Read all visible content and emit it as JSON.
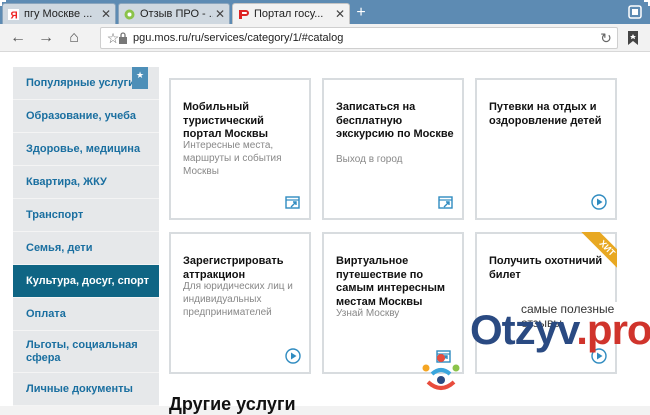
{
  "browser": {
    "tabs": [
      {
        "label": "пгу Москве ..."
      },
      {
        "label": "Отзыв ПРО - ..."
      },
      {
        "label": "Портал госу..."
      }
    ],
    "new_tab": "+",
    "address": "pgu.mos.ru/ru/services/category/1/#catalog"
  },
  "sidebar": {
    "items": [
      {
        "label": "Популярные услуги"
      },
      {
        "label": "Образование, учеба"
      },
      {
        "label": "Здоровье, медицина"
      },
      {
        "label": "Квартира, ЖКУ"
      },
      {
        "label": "Транспорт"
      },
      {
        "label": "Семья, дети"
      },
      {
        "label": "Культура, досуг, спорт"
      },
      {
        "label": "Оплата"
      },
      {
        "label": "Льготы, социальная сфера"
      },
      {
        "label": "Личные документы"
      }
    ],
    "badge": "★"
  },
  "cards": [
    {
      "title": "Мобильный туристический портал Москвы",
      "sub": "Интересные места, маршруты и события Москвы"
    },
    {
      "title": "Записаться на бесплатную экскурсию по Москве",
      "sub": "Выход в город"
    },
    {
      "title": "Путевки на отдых и оздоровление детей",
      "sub": ""
    },
    {
      "title": "Зарегистрировать аттракцион",
      "sub": "Для юридических лиц и индивидуальных предпринимателей"
    },
    {
      "title": "Виртуальное путешествие по самым интересным местам Москвы",
      "sub": "Узнай Москву"
    },
    {
      "title": "Получить охотничий билет",
      "sub": "",
      "ribbon": "ХИТ"
    }
  ],
  "other_services": "Другие услуги",
  "watermark": {
    "tagline": "самые полезные отзывы",
    "word_main": "Otzyv",
    "word_accent": ".pro"
  },
  "colors": {
    "accent": "#0f6584",
    "link": "#1a6fa0",
    "ribbon": "#e8a822"
  }
}
